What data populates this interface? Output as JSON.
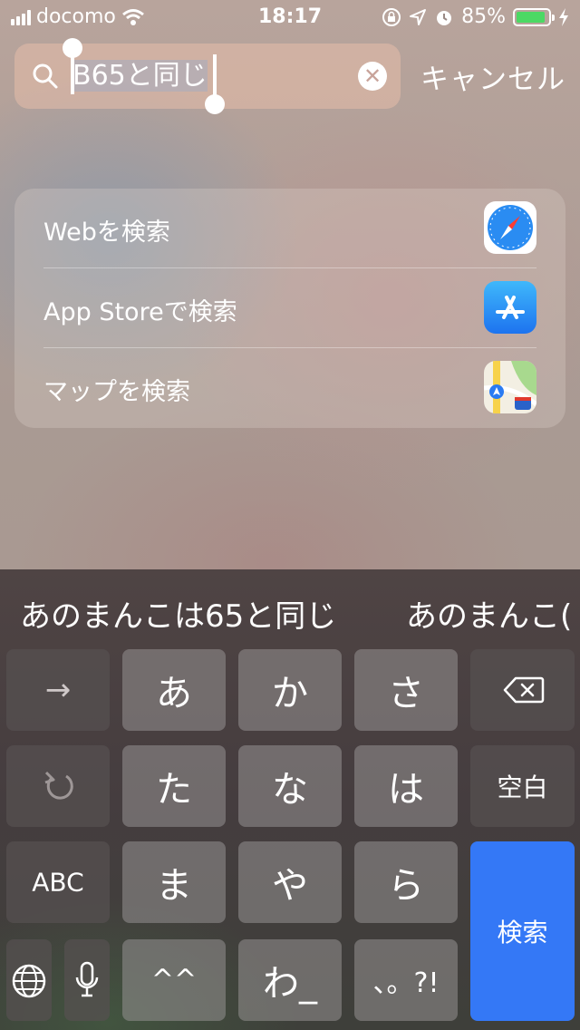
{
  "status": {
    "carrier": "docomo",
    "time": "18:17",
    "battery": "85%"
  },
  "search": {
    "query": "B65と同じ",
    "cancel_label": "キャンセル"
  },
  "suggestions": [
    {
      "label": "Webを検索",
      "app_icon": "safari-icon"
    },
    {
      "label": "App Storeで検索",
      "app_icon": "app-store-icon"
    },
    {
      "label": "マップを検索",
      "app_icon": "maps-icon"
    }
  ],
  "predictions": [
    "あのまんこは65と同じ",
    "あのまんこ("
  ],
  "keyboard": {
    "row1": [
      "→",
      "あ",
      "か",
      "さ",
      "⌫"
    ],
    "row2": [
      "↺",
      "た",
      "な",
      "は",
      "空白"
    ],
    "row3": [
      "ABC",
      "ま",
      "や",
      "ら",
      "検索"
    ],
    "row4": [
      "🌐",
      "🎤",
      "^^",
      "わ_",
      "、。?!"
    ],
    "accent": "#3478f6"
  }
}
